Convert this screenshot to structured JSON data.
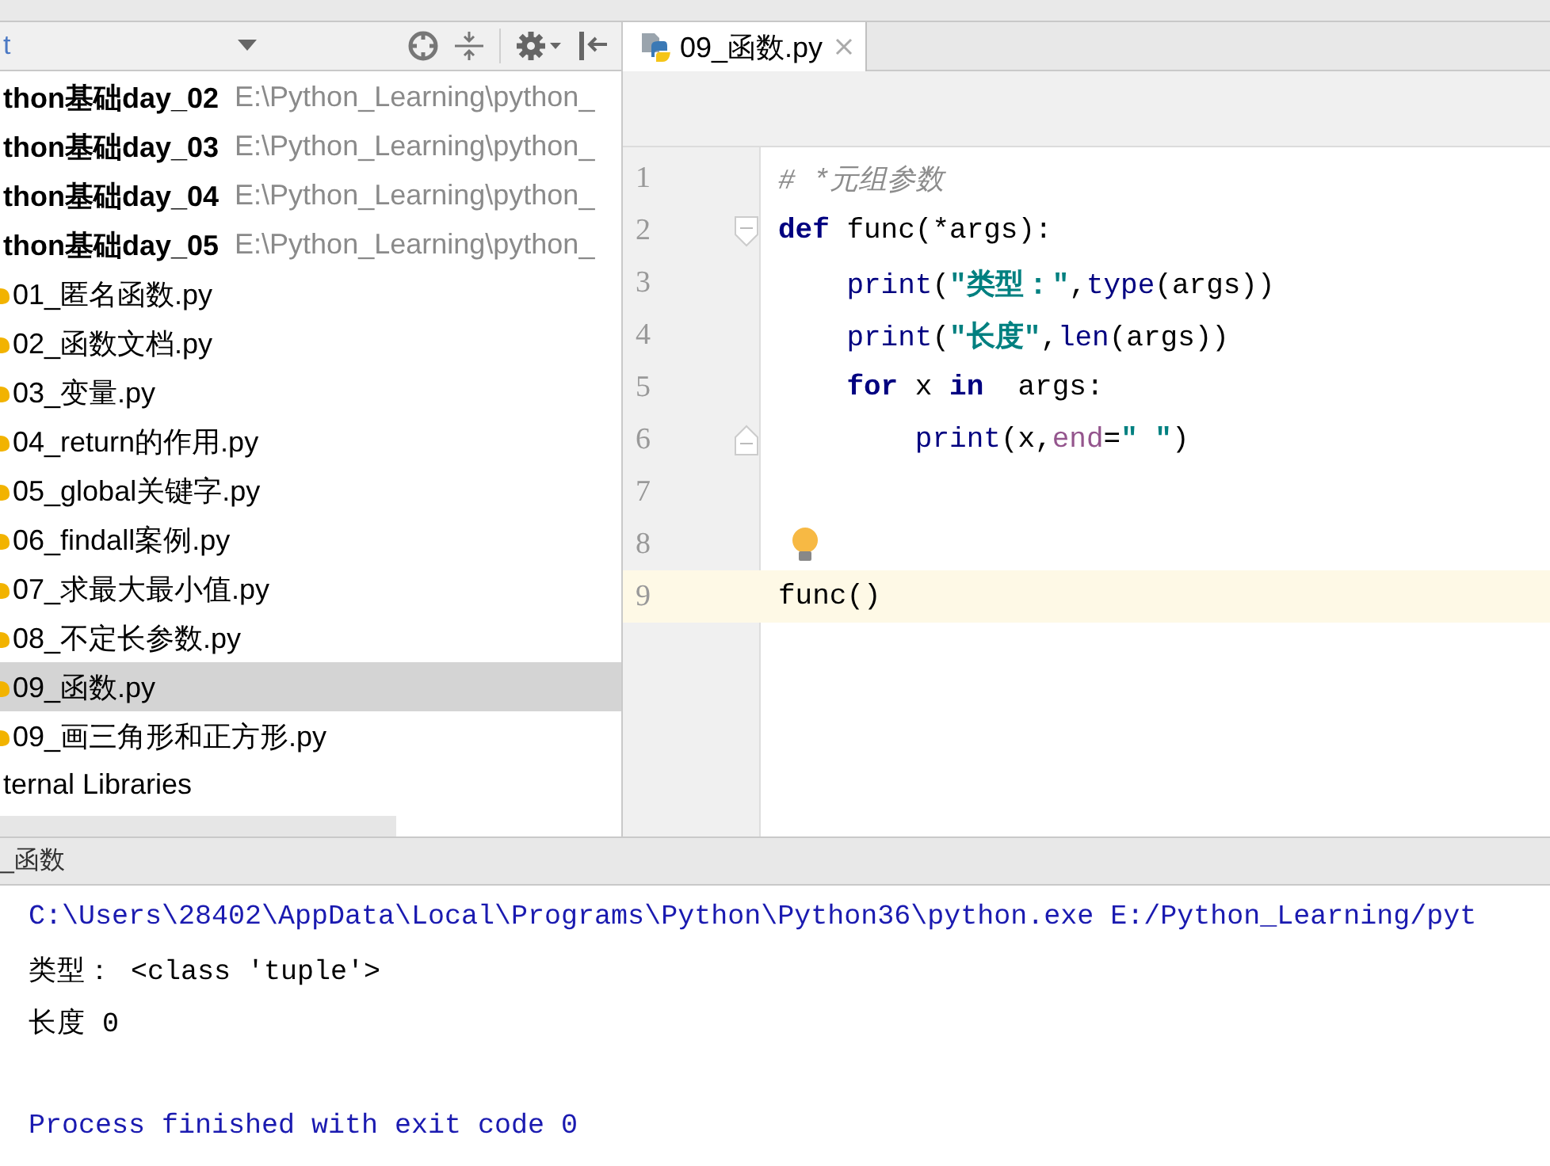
{
  "project_panel": {
    "view_selector": "t",
    "items": [
      {
        "kind": "module",
        "name": "thon基础day_02",
        "path": "E:\\Python_Learning\\python_",
        "selected": false
      },
      {
        "kind": "module",
        "name": "thon基础day_03",
        "path": "E:\\Python_Learning\\python_",
        "selected": false
      },
      {
        "kind": "module",
        "name": "thon基础day_04",
        "path": "E:\\Python_Learning\\python_",
        "selected": false
      },
      {
        "kind": "module",
        "name": "thon基础day_05",
        "path": "E:\\Python_Learning\\python_",
        "selected": false
      },
      {
        "kind": "file",
        "name": "01_匿名函数.py",
        "selected": false
      },
      {
        "kind": "file",
        "name": "02_函数文档.py",
        "selected": false
      },
      {
        "kind": "file",
        "name": "03_变量.py",
        "selected": false
      },
      {
        "kind": "file",
        "name": "04_return的作用.py",
        "selected": false
      },
      {
        "kind": "file",
        "name": "05_global关键字.py",
        "selected": false
      },
      {
        "kind": "file",
        "name": "06_findall案例.py",
        "selected": false
      },
      {
        "kind": "file",
        "name": "07_求最大最小值.py",
        "selected": false
      },
      {
        "kind": "file",
        "name": "08_不定长参数.py",
        "selected": false
      },
      {
        "kind": "file",
        "name": "09_函数.py",
        "selected": true
      },
      {
        "kind": "file",
        "name": "09_画三角形和正方形.py",
        "selected": false
      },
      {
        "kind": "library",
        "name": "ternal Libraries",
        "selected": false
      }
    ]
  },
  "editor": {
    "tabs": [
      {
        "label": "09_函数.py",
        "selected": true
      }
    ],
    "lines": [
      {
        "number": "1",
        "current": false,
        "bulb": false,
        "fold_open": false,
        "fold_close": false,
        "tokens": [
          {
            "kind": "comment",
            "text": "# *元组参数"
          }
        ]
      },
      {
        "number": "2",
        "current": false,
        "bulb": false,
        "fold_open": true,
        "fold_close": false,
        "tokens": [
          {
            "kind": "keyword",
            "text": "def"
          },
          {
            "kind": "plain",
            "text": " func(*args):"
          }
        ]
      },
      {
        "number": "3",
        "current": false,
        "bulb": false,
        "fold_open": false,
        "fold_close": false,
        "tokens": [
          {
            "kind": "builtin",
            "text": "    print"
          },
          {
            "kind": "plain",
            "text": "("
          },
          {
            "kind": "string",
            "text": "\"类型：\""
          },
          {
            "kind": "plain",
            "text": ","
          },
          {
            "kind": "builtin",
            "text": "type"
          },
          {
            "kind": "plain",
            "text": "(args))"
          }
        ]
      },
      {
        "number": "4",
        "current": false,
        "bulb": false,
        "fold_open": false,
        "fold_close": false,
        "tokens": [
          {
            "kind": "builtin",
            "text": "    print"
          },
          {
            "kind": "plain",
            "text": "("
          },
          {
            "kind": "string",
            "text": "\"长度\""
          },
          {
            "kind": "plain",
            "text": ","
          },
          {
            "kind": "builtin",
            "text": "len"
          },
          {
            "kind": "plain",
            "text": "(args))"
          }
        ]
      },
      {
        "number": "5",
        "current": false,
        "bulb": false,
        "fold_open": false,
        "fold_close": false,
        "tokens": [
          {
            "kind": "keyword",
            "text": "    for"
          },
          {
            "kind": "plain",
            "text": " x "
          },
          {
            "kind": "keyword",
            "text": "in"
          },
          {
            "kind": "plain",
            "text": "  args:"
          }
        ]
      },
      {
        "number": "6",
        "current": false,
        "bulb": false,
        "fold_open": false,
        "fold_close": true,
        "tokens": [
          {
            "kind": "builtin",
            "text": "        print"
          },
          {
            "kind": "plain",
            "text": "(x,"
          },
          {
            "kind": "param",
            "text": "end"
          },
          {
            "kind": "plain",
            "text": "="
          },
          {
            "kind": "string",
            "text": "\" \""
          },
          {
            "kind": "plain",
            "text": ")"
          }
        ]
      },
      {
        "number": "7",
        "current": false,
        "bulb": false,
        "fold_open": false,
        "fold_close": false
      },
      {
        "number": "8",
        "current": false,
        "bulb": true,
        "fold_open": false,
        "fold_close": false
      },
      {
        "number": "9",
        "current": true,
        "bulb": false,
        "fold_open": false,
        "fold_close": false,
        "tokens": [
          {
            "kind": "plain",
            "text": "func()"
          }
        ]
      }
    ]
  },
  "run_panel": {
    "title": "_函数",
    "lines": [
      {
        "kind": "command",
        "text": "C:\\Users\\28402\\AppData\\Local\\Programs\\Python\\Python36\\python.exe E:/Python_Learning/pyt"
      },
      {
        "kind": "output",
        "text": "类型： <class 'tuple'>"
      },
      {
        "kind": "output",
        "text": "长度 0"
      },
      {
        "kind": "blank"
      },
      {
        "kind": "exit",
        "text": "Process finished with exit code 0"
      }
    ]
  }
}
